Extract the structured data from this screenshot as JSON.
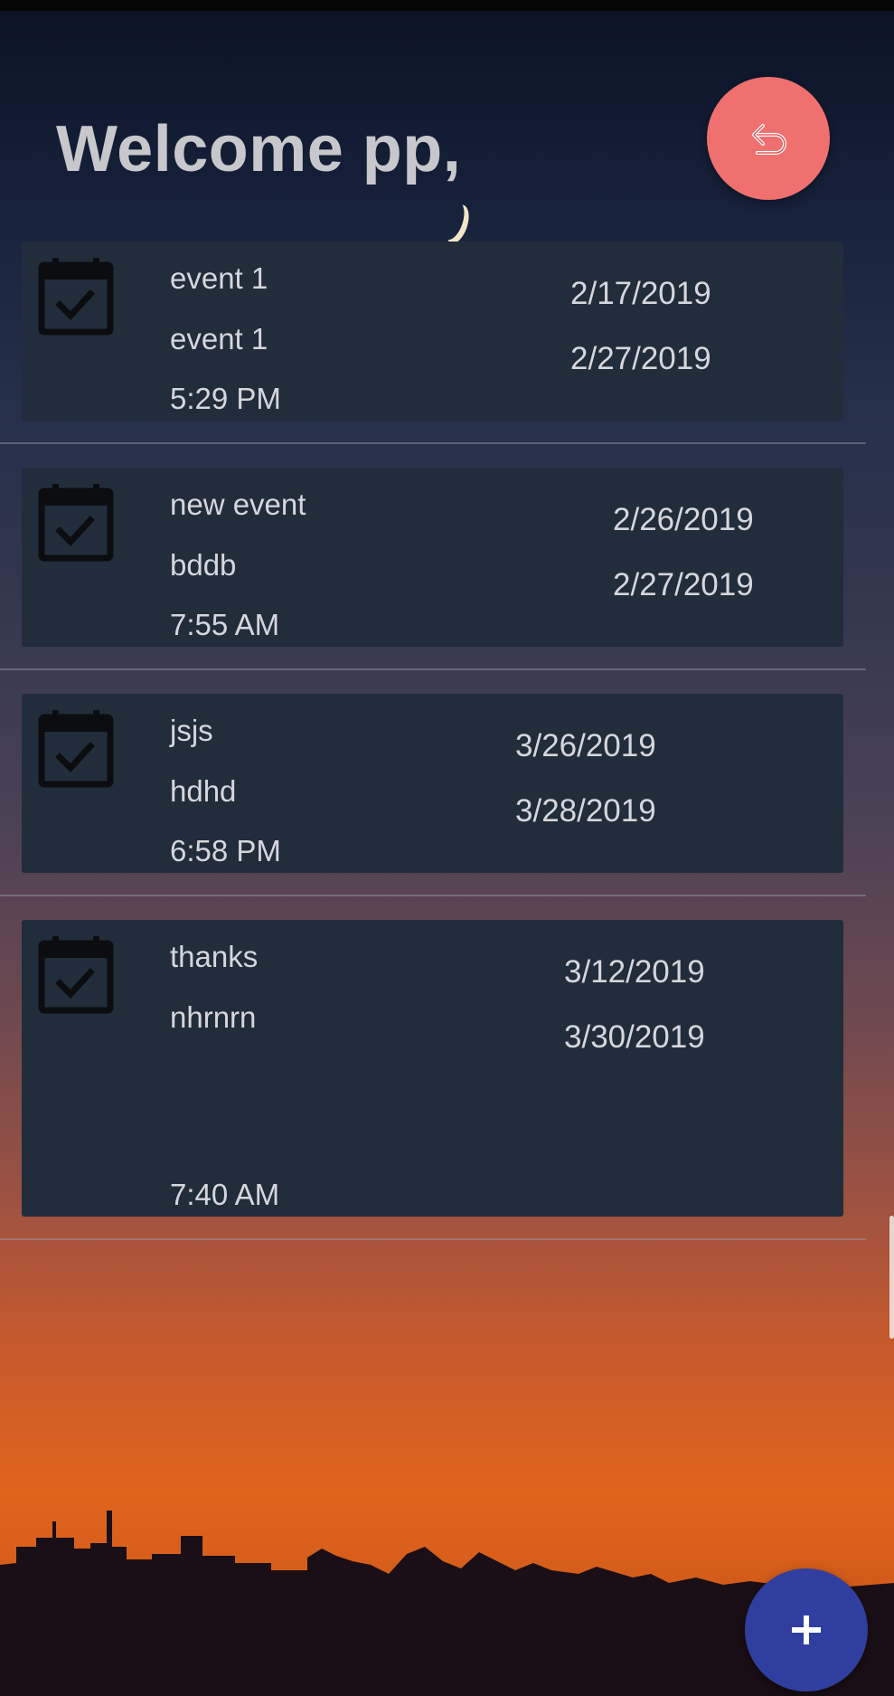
{
  "header": {
    "greeting": "Welcome pp,"
  },
  "icons": {
    "logout": "undo-arrow-icon",
    "event": "calendar-check-icon",
    "add": "plus-icon"
  },
  "colors": {
    "logout_button": "#f07070",
    "add_button": "#303f9f",
    "card_background": "#212d3b",
    "text": "#d5d7dc"
  },
  "events": [
    {
      "title": "event 1",
      "description": "event 1",
      "time": "5:29 PM",
      "start_date": "2/17/2019",
      "end_date": "2/27/2019"
    },
    {
      "title": "new event",
      "description": "bddb",
      "time": "7:55 AM",
      "start_date": "2/26/2019",
      "end_date": "2/27/2019"
    },
    {
      "title": "jsjs",
      "description": "hdhd",
      "time": "6:58 PM",
      "start_date": "3/26/2019",
      "end_date": "3/28/2019"
    },
    {
      "title": "thanks",
      "description": "nhrnrn",
      "time": "7:40 AM",
      "start_date": "3/12/2019",
      "end_date": "3/30/2019"
    }
  ]
}
